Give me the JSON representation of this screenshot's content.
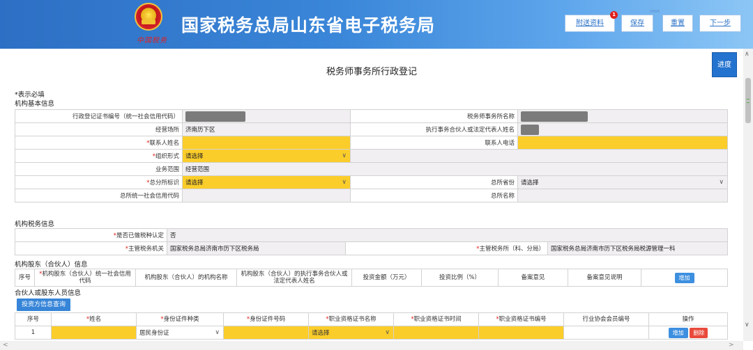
{
  "header": {
    "title": "国家税务总局山东省电子税务局",
    "motto": "中国税务",
    "buttons": {
      "attach": "附送资料",
      "save": "保存",
      "reset": "重置",
      "next": "下一步"
    },
    "attach_badge": "1"
  },
  "side": {
    "progress": "进度"
  },
  "page": {
    "title": "税务师事务所行政登记",
    "required_note": "*表示必填"
  },
  "basic": {
    "section": "机构基本信息",
    "reg_no_label": "行政登记证书编号（统一社会信用代码）",
    "firm_name_label": "税务师事务所名称",
    "address_label": "经营场所",
    "address_value": "济南历下区",
    "partner_label": "执行事务合伙人或法定代表人姓名",
    "contact_label": "联系人姓名",
    "phone_label": "联系人电话",
    "org_form_label": "组织形式",
    "org_form_value": "请选择",
    "scope_label": "业务范围",
    "scope_value": "经营范围",
    "branch_flag_label": "总分所标识",
    "branch_flag_value": "请选择",
    "hq_province_label": "总所省份",
    "hq_province_value": "请选择",
    "hq_code_label": "总所统一社会信用代码",
    "hq_name_label": "总所名称"
  },
  "tax": {
    "section": "机构税务信息",
    "tax_type_label": "是否已做税种认定",
    "tax_type_value": "否",
    "authority_label": "主管税务机关",
    "authority_value": "国家税务总局济南市历下区税务局",
    "branch_label": "主管税务所（科、分局）",
    "branch_value": "国家税务总局济南市历下区税务局税源管理一科"
  },
  "shareholders": {
    "section": "机构股东（合伙人）信息",
    "columns": [
      "序号",
      "机构股东（合伙人）统一社会信用代码",
      "机构股东（合伙人）的机构名称",
      "机构股东（合伙人）的执行事务合伙人或法定代表人姓名",
      "投资金额（万元）",
      "投资比例（%）",
      "备案意见",
      "备案意见说明"
    ],
    "add": "增加"
  },
  "persons": {
    "section": "合伙人或股东人员信息",
    "query": "投资方信息查询",
    "columns": [
      "序号",
      "姓名",
      "身份证件种类",
      "身份证件号码",
      "职业资格证书名称",
      "职业资格证书时间",
      "职业资格证书编号",
      "行业协会会员编号",
      "操作"
    ],
    "rows": [
      {
        "no": "1",
        "id_type": "居民身份证",
        "cert": "请选择",
        "add": "增加",
        "del": "删除"
      }
    ]
  },
  "colors": {
    "required_field": "#fbcd2a",
    "header_start": "#2d6fc4",
    "accent": "#2473cf",
    "delete": "#e84a3b"
  }
}
